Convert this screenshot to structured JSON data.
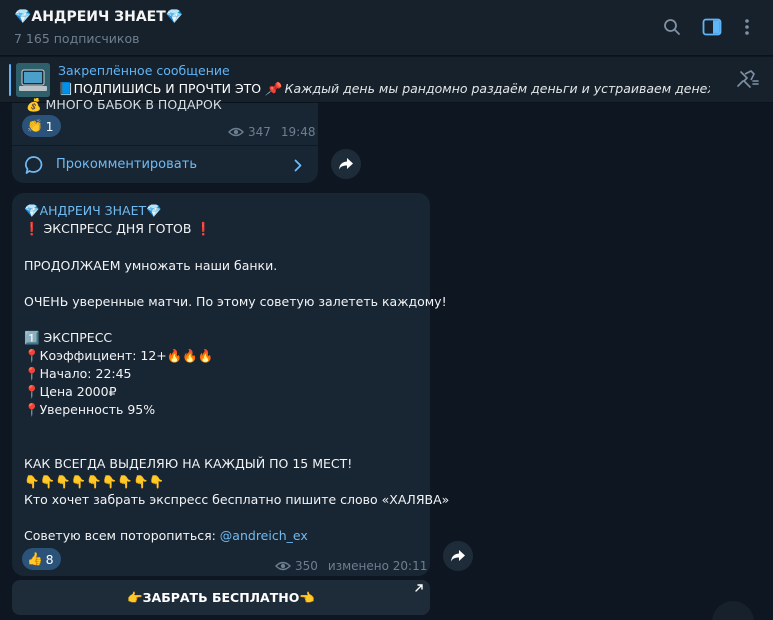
{
  "header": {
    "title": "💎АНДРЕИЧ ЗНАЕТ💎",
    "subscribers": "7 165 подписчиков",
    "icons": [
      "search-icon",
      "sidebar-toggle-icon",
      "more-vertical-icon"
    ]
  },
  "pinned": {
    "title": "Закреплённое сообщение",
    "text_strong": "📘ПОДПИШИСЬ И ПРОЧТИ ЭТО",
    "text_italic": "📌 Каждый день мы рандомно раздаём деньги и устраиваем денежн..."
  },
  "prev_message": {
    "cut_text": "💰 МНОГО БАБОК В ПОДАРОК",
    "reaction_emoji": "👏",
    "reaction_count": "1",
    "views": "347",
    "time": "19:48",
    "comment_label": "Прокомментировать"
  },
  "main_message": {
    "author": "💎АНДРЕИЧ ЗНАЕТ💎",
    "line1": "❗ ЭКСПРЕСС ДНЯ ГОТОВ ❗",
    "line2": "ПРОДОЛЖАЕМ умножать наши банки.",
    "line3": "ОЧЕНЬ уверенные матчи. По этому советую залететь каждому!",
    "express_title": "1️⃣ ЭКСПРЕСС",
    "coef": "📍Коэффициент: 12+🔥🔥🔥",
    "start": "📍Начало: 22:45",
    "price": "📍Цена 2000₽",
    "confidence": "📍Уверенность 95%",
    "line4": "КАК ВСЕГДА ВЫДЕЛЯЮ НА КАЖДЫЙ ПО 15 МЕСТ!",
    "fingers": "👇👇👇👇👇👇👇👇👇",
    "line5": "Кто хочет забрать экспресс бесплатно пишите слово «ХАЛЯВА»",
    "line6_prefix": "Советую всем поторопиться: ",
    "line6_link": "@andreich_ex",
    "reaction_emoji": "👍",
    "reaction_count": "8",
    "views": "350",
    "edited": "изменено 20:11"
  },
  "cta": {
    "label": "👉ЗАБРАТЬ БЕСПЛАТНО👈"
  },
  "colors": {
    "bg": "#0e1621",
    "bubble": "#182533",
    "accent": "#71baf2",
    "reaction": "#2b5278"
  }
}
